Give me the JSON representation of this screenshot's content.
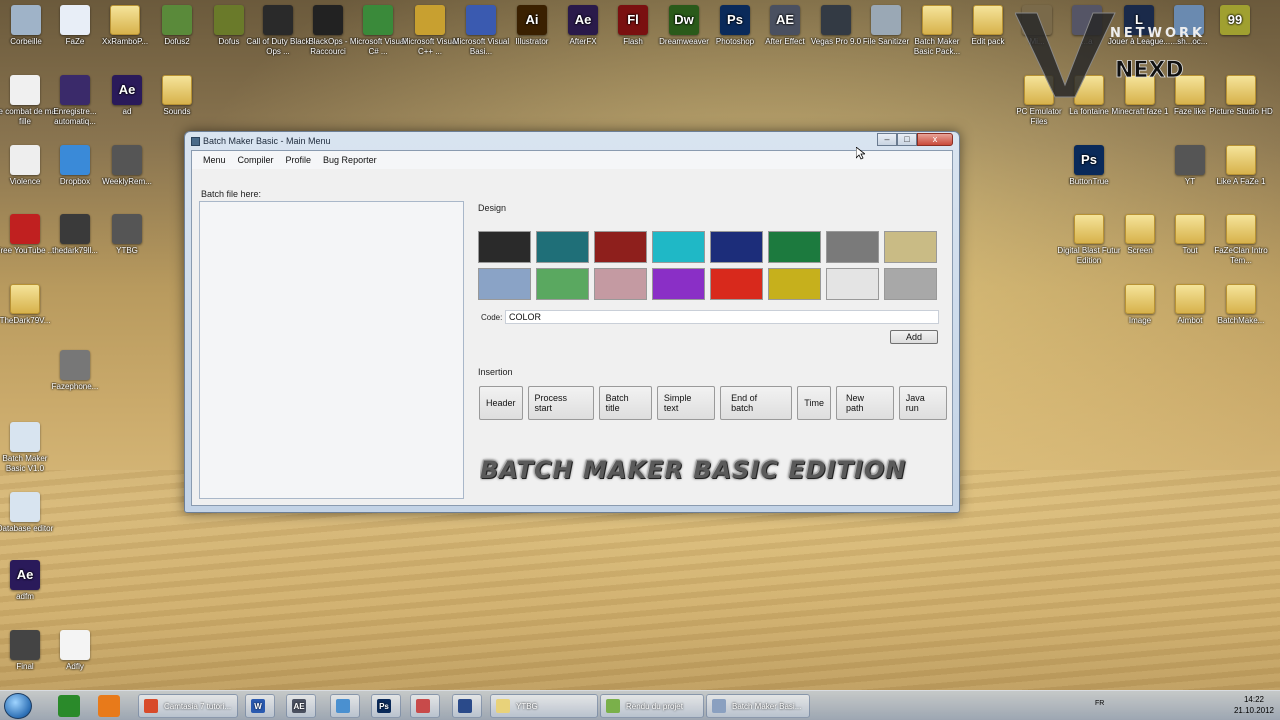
{
  "desktop": {
    "top_row": [
      {
        "label": "Corbeille",
        "icon": "recycle-bin-icon",
        "color": "#9fb3c8"
      },
      {
        "label": "FaZe",
        "icon": "wma-file-icon",
        "color": "#e8eef7"
      },
      {
        "label": "XxRamboP...",
        "icon": "folder-icon",
        "color": "#e8d27a"
      },
      {
        "label": "Dofus2",
        "icon": "dofus-icon",
        "color": "#5a8a3a"
      },
      {
        "label": "Dofus",
        "icon": "dofus-icon",
        "color": "#6a7a2a"
      },
      {
        "label": "Call of Duty Black Ops ...",
        "icon": "black-ops-icon",
        "color": "#2a2a2a"
      },
      {
        "label": "BlackOps - Raccourci",
        "icon": "black-ops-icon",
        "color": "#222"
      },
      {
        "label": "Microsoft Visual C# ...",
        "icon": "visual-csharp-icon",
        "color": "#3a8a3a"
      },
      {
        "label": "Microsoft Visual C++ ...",
        "icon": "visual-cpp-icon",
        "color": "#c8a030"
      },
      {
        "label": "Microsoft Visual Basi...",
        "icon": "visual-basic-icon",
        "color": "#3a5ab0"
      },
      {
        "label": "Illustrator",
        "icon": "illustrator-icon",
        "color": "#3a2000",
        "text": "Ai"
      },
      {
        "label": "AfterFX",
        "icon": "after-effects-icon",
        "color": "#2a1a4a",
        "text": "Ae"
      },
      {
        "label": "Flash",
        "icon": "flash-icon",
        "color": "#7a1010",
        "text": "Fl"
      },
      {
        "label": "Dreamweaver",
        "icon": "dreamweaver-icon",
        "color": "#2a5a1a",
        "text": "Dw"
      },
      {
        "label": "Photoshop",
        "icon": "photoshop-icon",
        "color": "#0a2a5a",
        "text": "Ps"
      },
      {
        "label": "After Effect",
        "icon": "after-effects-icon",
        "color": "#4a5060",
        "text": "AE"
      },
      {
        "label": "Vegas Pro 9.0",
        "icon": "vegas-icon",
        "color": "#333a44"
      },
      {
        "label": "File Sanitizer",
        "icon": "trash-can-icon",
        "color": "#9aa8b5"
      },
      {
        "label": "Batch Maker Basic Pack...",
        "icon": "folder-icon",
        "color": "#e8d27a"
      },
      {
        "label": "Edit pack",
        "icon": "folder-icon",
        "color": "#e8d27a"
      },
      {
        "label": "Mi...",
        "icon": "minecraft-icon",
        "color": "#7a6a4a"
      },
      {
        "label": "...a",
        "icon": "app-icon",
        "color": "#556"
      },
      {
        "label": "Jouer à League...",
        "icon": "league-icon",
        "color": "#1a2a4a",
        "text": "L"
      },
      {
        "label": "...sh...oc...",
        "icon": "network-icon",
        "color": "#6a8ab0"
      },
      {
        "label": "",
        "icon": "game-icon",
        "color": "#a0a030",
        "text": "99"
      }
    ],
    "left_column": [
      {
        "label": "Le combat de ma fille",
        "icon": "word-document-icon",
        "color": "#f0f0f0"
      },
      {
        "label": "Enregistre... automatiq...",
        "icon": "aep-file-icon",
        "color": "#3a2a6a"
      },
      {
        "label": "ad",
        "icon": "aep-file-icon",
        "color": "#2a1a5a",
        "text": "Ae"
      },
      {
        "label": "Sounds",
        "icon": "folder-icon",
        "color": "#e8d27a"
      },
      {
        "label": "Violence",
        "icon": "video-file-icon",
        "color": "#eee"
      },
      {
        "label": "Dropbox",
        "icon": "dropbox-icon",
        "color": "#3a8ad8"
      },
      {
        "label": "WeeklyRem...",
        "icon": "film-file-icon",
        "color": "#555"
      },
      {
        "label": "Free YouTube ...",
        "icon": "youtube-downloader-icon",
        "color": "#c02020"
      },
      {
        "label": "thedark79ll...",
        "icon": "shortcut-icon",
        "color": "#3a3a3a"
      },
      {
        "label": "YTBG",
        "icon": "film-file-icon",
        "color": "#555"
      },
      {
        "label": "TheDark79V...",
        "icon": "folder-icon",
        "color": "#e8d27a"
      },
      {
        "label": "Fazephone...",
        "icon": "file-icon",
        "color": "#777"
      },
      {
        "label": "Batch Maker Basic V1.0",
        "icon": "batch-file-icon",
        "color": "#d8e4f0"
      },
      {
        "label": "Database editor",
        "icon": "batch-file-icon",
        "color": "#d8e4f0"
      },
      {
        "label": "adfm",
        "icon": "aep-file-icon",
        "color": "#2a1a5a",
        "text": "Ae"
      },
      {
        "label": "Final",
        "icon": "image-file-icon",
        "color": "#444"
      },
      {
        "label": "Adfly",
        "icon": "text-file-icon",
        "color": "#f4f4f4"
      }
    ],
    "right_column": [
      {
        "label": "PC Emulator Files",
        "icon": "folder-icon",
        "color": "#e8d27a"
      },
      {
        "label": "La fontaine",
        "icon": "folder-icon",
        "color": "#e8d27a"
      },
      {
        "label": "Minecraft faze 1",
        "icon": "folder-icon",
        "color": "#e8d27a"
      },
      {
        "label": "Faze like",
        "icon": "folder-icon",
        "color": "#e8d27a"
      },
      {
        "label": "Picture Studio HD",
        "icon": "folder-icon",
        "color": "#e8d27a"
      },
      {
        "label": "ButtonTrue",
        "icon": "psd-file-icon",
        "color": "#0a2a5a",
        "text": "Ps"
      },
      {
        "label": "YT",
        "icon": "film-folder-icon",
        "color": "#555"
      },
      {
        "label": "Like A FaZe 1",
        "icon": "folder-icon",
        "color": "#e8d27a"
      },
      {
        "label": "Digital Blast Futur Edition",
        "icon": "folder-icon",
        "color": "#e8d27a"
      },
      {
        "label": "Screen",
        "icon": "folder-icon",
        "color": "#e8d27a"
      },
      {
        "label": "Tout",
        "icon": "folder-icon",
        "color": "#e8d27a"
      },
      {
        "label": "FaZeClan Intro Tem...",
        "icon": "folder-icon",
        "color": "#e8d27a"
      },
      {
        "label": "Image",
        "icon": "folder-icon",
        "color": "#e8d27a"
      },
      {
        "label": "Aimbot",
        "icon": "folder-icon",
        "color": "#e8d27a"
      },
      {
        "label": "BatchMake...",
        "icon": "folder-icon",
        "color": "#e8d27a"
      }
    ],
    "watermark": {
      "line1": "NETWORK",
      "line2": "NEXD",
      "letter": "V"
    }
  },
  "window": {
    "title": "Batch Maker Basic - Main Menu",
    "menu": [
      "Menu",
      "Compiler",
      "Profile",
      "Bug Reporter"
    ],
    "batch_label": "Batch file here:",
    "design_title": "Design",
    "swatches": [
      "#2a2a2a",
      "#1f6f78",
      "#8e1f1c",
      "#1fb8c6",
      "#1c2d7a",
      "#1c7a3e",
      "#7a7a7a",
      "#c9bb85",
      "#8aa3c6",
      "#5aa860",
      "#c49aa2",
      "#8a2fc6",
      "#d8291c",
      "#c6b01c",
      "#e4e4e4",
      "#a8a8a8"
    ],
    "code_label": "Code:",
    "code_value": "COLOR",
    "add_label": "Add",
    "insertion_title": "Insertion",
    "insert_buttons": [
      "Header",
      "Process start",
      "Batch title",
      "Simple text",
      "End of batch",
      "Time",
      "New path",
      "Java run"
    ],
    "banner": "BATCH MAKER BASIC EDITION",
    "controls": {
      "minimize": "–",
      "maximize": "□",
      "close": "x"
    }
  },
  "taskbar": {
    "pinned": [
      {
        "icon": "camtasia-icon",
        "color": "#2a8a2a"
      },
      {
        "icon": "media-player-icon",
        "color": "#e87a1a"
      }
    ],
    "tasks": [
      {
        "label": "Camtasia 7 tutori...",
        "icon": "chrome-icon",
        "color": "#d84a2a"
      },
      {
        "label": "",
        "icon": "word-icon",
        "color": "#2a5ab0",
        "text": "W"
      },
      {
        "label": "",
        "icon": "after-effects-icon",
        "color": "#4a5060",
        "text": "AE"
      },
      {
        "label": "",
        "icon": "wifi-icon",
        "color": "#4a90d0"
      },
      {
        "label": "",
        "icon": "photoshop-icon",
        "color": "#0a2a5a",
        "text": "Ps"
      },
      {
        "label": "",
        "icon": "paint-icon",
        "color": "#c84a4a"
      },
      {
        "label": "",
        "icon": "globe-icon",
        "color": "#2a4a8a"
      },
      {
        "label": "YTBG",
        "icon": "folder-icon",
        "color": "#e8d27a"
      },
      {
        "label": "Rendu du projet",
        "icon": "folder-icon",
        "color": "#7ab04a"
      },
      {
        "label": "Batch Maker Basi...",
        "icon": "app-window-icon",
        "color": "#8aa0c0"
      }
    ],
    "language": "FR",
    "time": "14:22",
    "date": "21.10.2012"
  }
}
